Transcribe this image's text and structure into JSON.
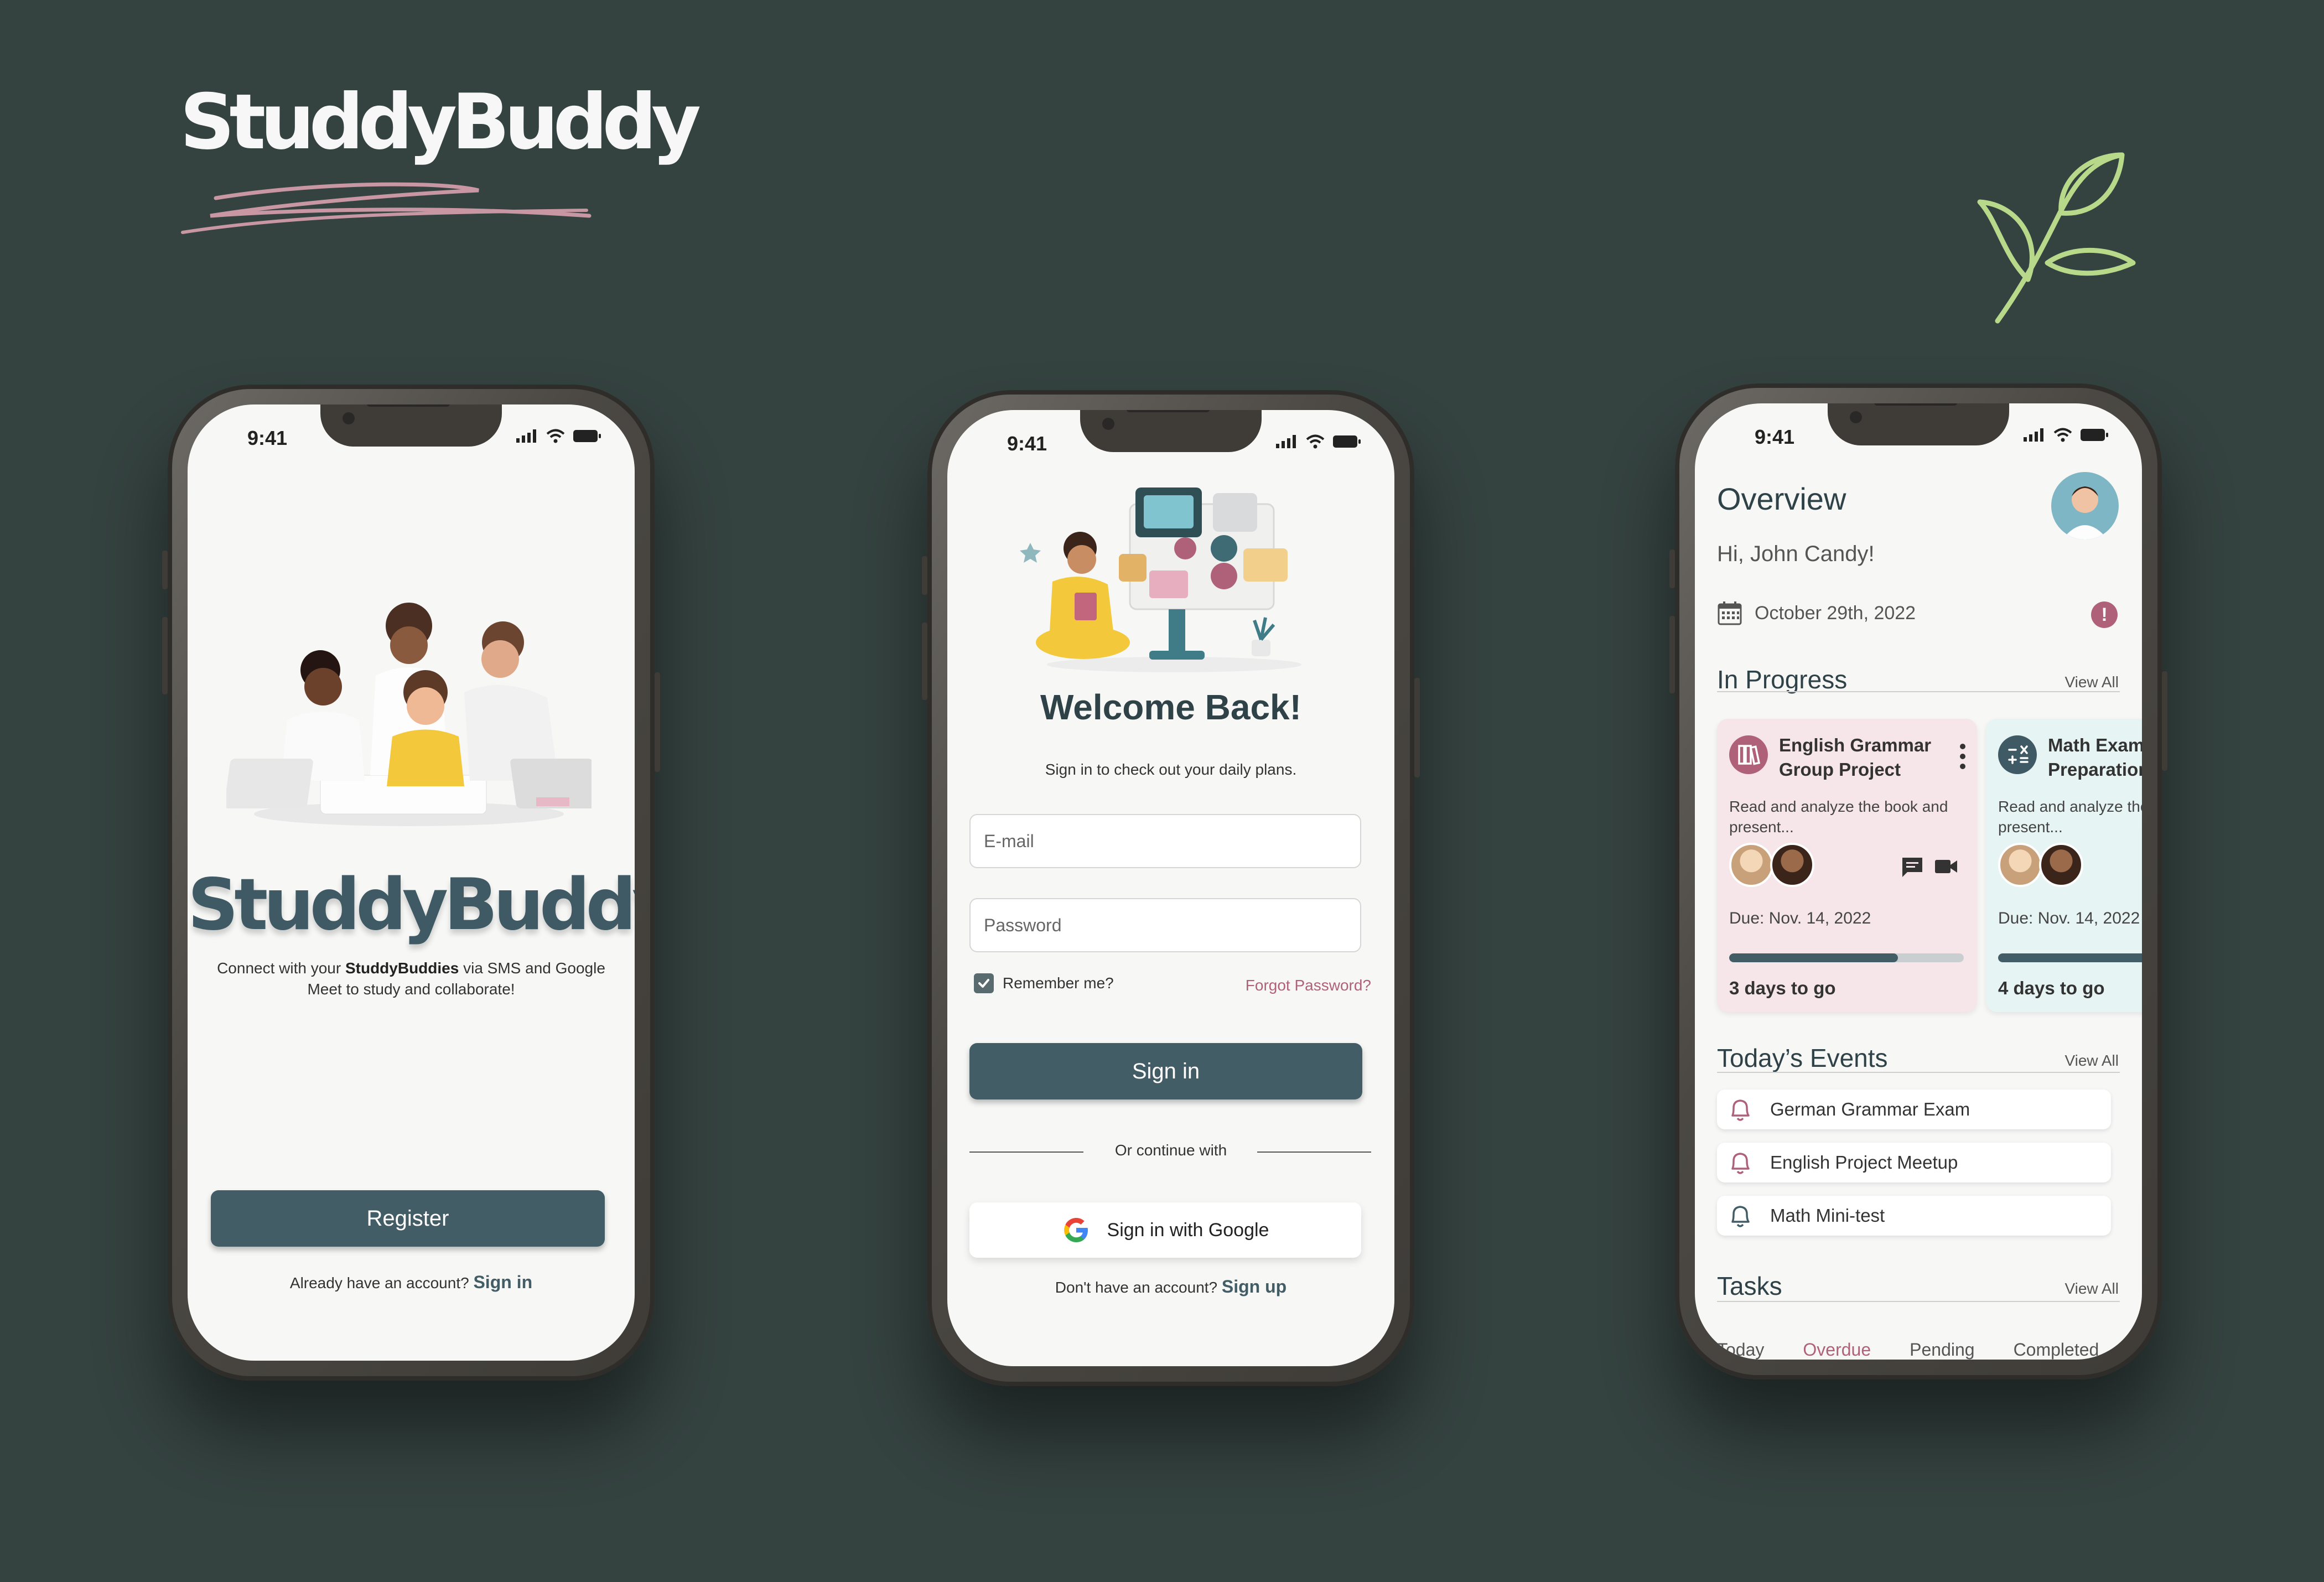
{
  "brand": {
    "name": "StuddyBuddy"
  },
  "status_bar": {
    "time": "9:41"
  },
  "landing": {
    "app_title": "StuddyBuddy",
    "description_prefix": "Connect with your ",
    "description_bold": "StuddyBuddies",
    "description_suffix": " via SMS and Google Meet to study and collaborate!",
    "register_label": "Register",
    "account_prompt": "Already have an account? ",
    "signin_link": "Sign in"
  },
  "login": {
    "title": "Welcome Back!",
    "subtitle": "Sign in to check out your daily plans.",
    "email_placeholder": "E-mail",
    "password_placeholder": "Password",
    "remember_label": "Remember me?",
    "remember_checked": true,
    "forgot_label": "Forgot Password?",
    "signin_label": "Sign in",
    "divider_text": "Or continue with",
    "google_label": "Sign in with Google",
    "no_account_prompt": "Don't have an account? ",
    "signup_link": "Sign up"
  },
  "overview": {
    "title": "Overview",
    "greeting": "Hi, John Candy!",
    "date": "October 29th, 2022",
    "alert_symbol": "!",
    "in_progress_title": "In Progress",
    "view_all": "View All",
    "cards": [
      {
        "title": "English Grammar Group Project",
        "description": "Read and analyze the book and present...",
        "due": "Due: Nov. 14, 2022",
        "progress": 0.72,
        "time_left": "3 days to go",
        "icon": "books-icon",
        "bg": "#f6e6ea"
      },
      {
        "title": "Math Exam Preparation",
        "description": "Read and analyze the book and present...",
        "due": "Due: Nov. 14, 2022",
        "progress": 0.85,
        "time_left": "4 days to go",
        "icon": "calculator-icon",
        "bg": "#e7f4f4"
      }
    ],
    "events_title": "Today’s Events",
    "events": [
      "German Grammar Exam",
      "English Project Meetup",
      "Math Mini-test"
    ],
    "tasks_title": "Tasks",
    "tabs": [
      "Today",
      "Overdue",
      "Pending",
      "Completed"
    ]
  },
  "colors": {
    "background": "#344240",
    "primary": "#435d67",
    "accent": "#b0617a",
    "leaf": "#b8d98a"
  }
}
